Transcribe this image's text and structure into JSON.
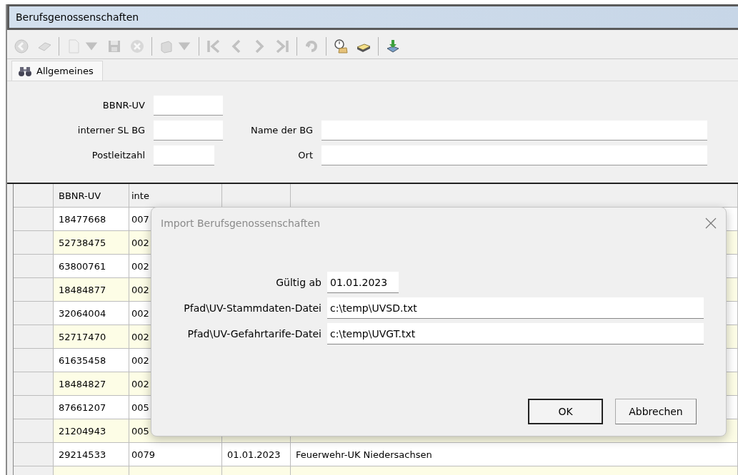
{
  "window": {
    "title": "Berufsgenossenschaften"
  },
  "toolbar": [
    {
      "kind": "back",
      "disabled": true
    },
    {
      "kind": "eraser",
      "disabled": true
    },
    {
      "kind": "separator"
    },
    {
      "kind": "new",
      "disabled": true
    },
    {
      "kind": "save",
      "disabled": true
    },
    {
      "kind": "cancel",
      "disabled": true
    },
    {
      "kind": "separator"
    },
    {
      "kind": "print",
      "disabled": true
    },
    {
      "kind": "separator"
    },
    {
      "kind": "first",
      "disabled": true
    },
    {
      "kind": "previous",
      "disabled": true
    },
    {
      "kind": "next",
      "disabled": true
    },
    {
      "kind": "last",
      "disabled": true
    },
    {
      "kind": "separator"
    },
    {
      "kind": "refresh",
      "disabled": true
    },
    {
      "kind": "separator"
    },
    {
      "kind": "stopwatch",
      "disabled": false
    },
    {
      "kind": "drawer",
      "disabled": false
    },
    {
      "kind": "separator"
    },
    {
      "kind": "download",
      "disabled": false
    }
  ],
  "tabs": [
    {
      "label": "Allgemeines",
      "selected": true
    }
  ],
  "filter": {
    "bbnr_label": "BBNR-UV",
    "sl_label": "interner SL BG",
    "name_label": "Name der BG",
    "plz_label": "Postleitzahl",
    "ort_label": "Ort"
  },
  "table": {
    "columns": [
      "BBNR-UV",
      "inte"
    ],
    "rows": [
      {
        "cells": [
          "18477668",
          "007"
        ],
        "shaded": false
      },
      {
        "cells": [
          "52738475",
          "002"
        ],
        "shaded": true
      },
      {
        "cells": [
          "63800761",
          "002"
        ],
        "shaded": false
      },
      {
        "cells": [
          "18484877",
          "002"
        ],
        "shaded": true
      },
      {
        "cells": [
          "32064004",
          "002"
        ],
        "shaded": false
      },
      {
        "cells": [
          "52717470",
          "002"
        ],
        "shaded": true
      },
      {
        "cells": [
          "61635458",
          "002"
        ],
        "shaded": false
      },
      {
        "cells": [
          "18484827",
          "002"
        ],
        "shaded": true
      },
      {
        "cells": [
          "87661207",
          "005"
        ],
        "shaded": false
      },
      {
        "cells": [
          "21204943",
          "005"
        ],
        "shaded": true
      },
      {
        "cells": [
          "29214533",
          "0079",
          "01.01.2023",
          "Feuerwehr-UK Niedersachsen"
        ],
        "shaded": false
      }
    ]
  },
  "dialog": {
    "title": "Import Berufsgenossenschaften",
    "fields": [
      {
        "label": "Gültig ab",
        "value": "01.01.2023",
        "kind": "short"
      },
      {
        "label": "Pfad\\UV-Stammdaten-Datei",
        "value": "c:\\temp\\UVSD.txt",
        "kind": "long"
      },
      {
        "label": "Pfad\\UV-Gefahrtarife-Datei",
        "value": "c:\\temp\\UVGT.txt",
        "kind": "long"
      }
    ],
    "buttons": [
      {
        "label": "OK",
        "default": true
      },
      {
        "label": "Abbrechen",
        "default": false
      }
    ]
  }
}
